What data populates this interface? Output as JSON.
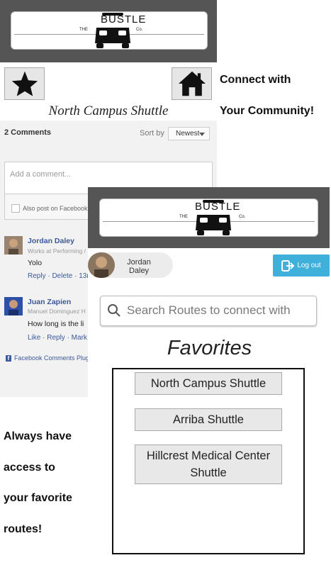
{
  "back_screen": {
    "logo": {
      "the": "THE",
      "bustle": "BUSTLE",
      "co": "Co."
    },
    "star_icon": "star-icon",
    "home_icon": "home-icon",
    "route_title": "North Campus Shuttle",
    "comments": {
      "count_label": "2 Comments",
      "sort_label": "Sort by",
      "sort_value": "Newest",
      "input_placeholder": "Add a comment...",
      "post_facebook_label": "Also post on Facebook",
      "items": [
        {
          "name": "Jordan Daley",
          "work": "Works at Performing /",
          "text": "Yolo",
          "actions": "Reply · Delete · 13m"
        },
        {
          "name": "Juan Zapien",
          "work": "Manuel Dominguez H",
          "text": "How long is the li",
          "actions": "Like · Reply · Mark"
        }
      ],
      "plugin_label": "Facebook Comments Plug"
    }
  },
  "connect_text": [
    "Connect with",
    "Your Community!"
  ],
  "promo_text": [
    "Always have",
    "access to",
    "your favorite",
    "routes!"
  ],
  "front_screen": {
    "logo": {
      "the": "THE",
      "bustle": "BUSTLE",
      "co": "Co."
    },
    "user": {
      "first_name": "Jordan",
      "last_name": "Daley"
    },
    "logout_label": "Log out",
    "search_placeholder": "Search Routes to connect with",
    "favorites_title": "Favorites",
    "favorites": [
      "North Campus Shuttle",
      "Arriba Shuttle",
      "Hillcrest Medical Center Shuttle"
    ]
  },
  "colors": {
    "header_gray": "#555555",
    "logout_blue": "#3fb0d9",
    "facebook_blue": "#3b5998"
  }
}
